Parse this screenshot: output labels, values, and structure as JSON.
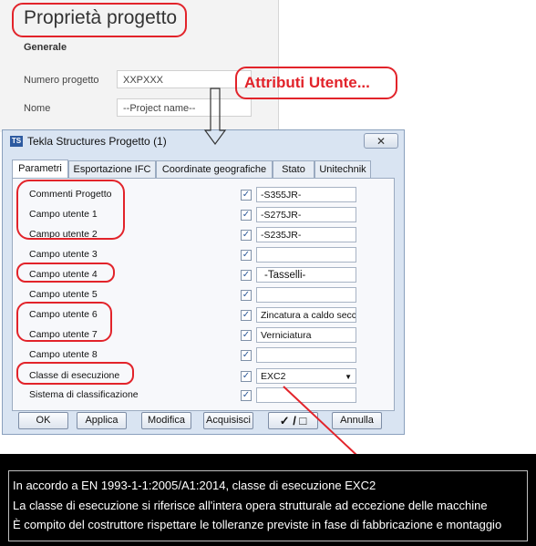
{
  "background_panel": {
    "title": "Proprietà progetto",
    "section": "Generale",
    "fields": [
      {
        "label": "Numero progetto",
        "value": "XXPXXX"
      },
      {
        "label": "Nome",
        "value": "--Project name--"
      }
    ]
  },
  "annotation": {
    "text": "Attributi Utente..."
  },
  "dialog": {
    "title": "Tekla Structures  Progetto (1)",
    "close_icon": "close-icon",
    "tabs": [
      "Parametri",
      "Esportazione IFC",
      "Coordinate geografiche",
      "Stato",
      "Unitechnik"
    ],
    "rows": [
      {
        "label": "Commenti Progetto",
        "checked": true,
        "value": "-S355JR-"
      },
      {
        "label": "Campo utente 1",
        "checked": true,
        "value": "-S275JR-"
      },
      {
        "label": "Campo utente 2",
        "checked": true,
        "value": "-S235JR-"
      },
      {
        "label": "Campo utente 3",
        "checked": true,
        "value": ""
      },
      {
        "label": "Campo utente 4",
        "checked": true,
        "value": "-Tasselli-"
      },
      {
        "label": "Campo utente 5",
        "checked": true,
        "value": ""
      },
      {
        "label": "Campo utente 6",
        "checked": true,
        "value": "Zincatura a caldo secc"
      },
      {
        "label": "Campo utente 7",
        "checked": true,
        "value": "Verniciatura"
      },
      {
        "label": "Campo utente 8",
        "checked": true,
        "value": ""
      },
      {
        "label": "Classe di esecuzione",
        "checked": true,
        "value": "EXC2"
      },
      {
        "label": "Sistema di classificazione",
        "checked": true,
        "value": ""
      }
    ],
    "buttons": {
      "ok": "OK",
      "apply": "Applica",
      "modify": "Modifica",
      "acquire": "Acquisisci",
      "toggle": "✓ / □",
      "cancel": "Annulla"
    }
  },
  "banner": {
    "line1_prefix": "In accordo a EN 1993-1-1:2005/A1:2014, classe di esecuzione ",
    "line1_value": "EXC2",
    "line2": "La classe di esecuzione si riferisce all'intera opera strutturale ad eccezione delle macchine",
    "line3": "È compito del costruttore rispettare le tolleranze previste in fase di fabbricazione e montaggio"
  },
  "colors": {
    "annotation_red": "#e2232a",
    "dialog_bg": "#d9e4f2",
    "banner_bg": "#000000"
  }
}
